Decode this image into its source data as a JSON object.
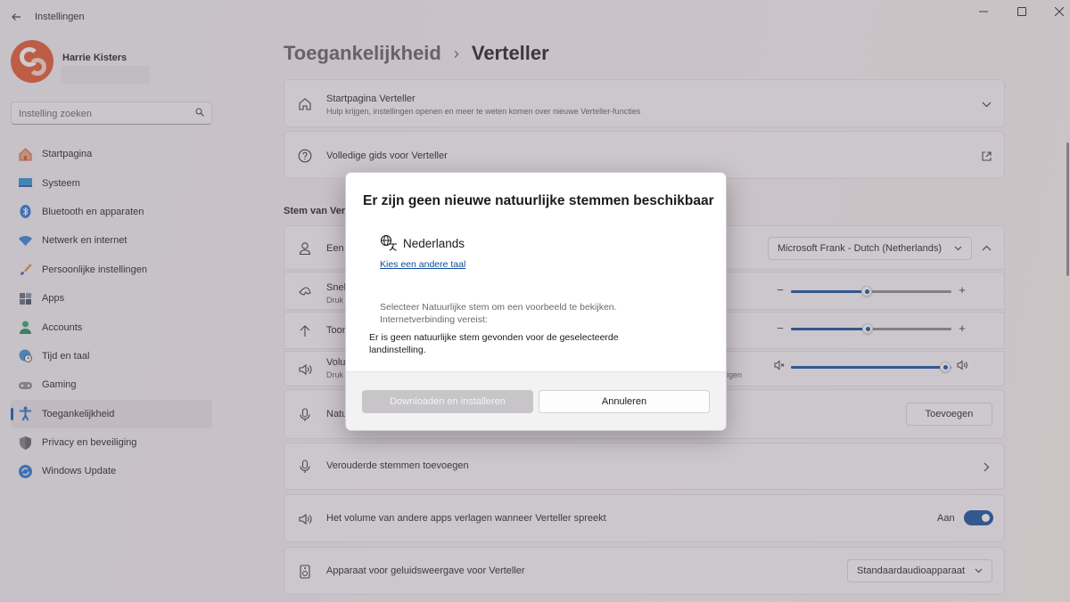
{
  "app": {
    "title": "Instellingen"
  },
  "user": {
    "name": "Harrie Kisters"
  },
  "search": {
    "placeholder": "Instelling zoeken"
  },
  "sidebar": {
    "items": [
      {
        "label": "Startpagina",
        "icon": "home-icon"
      },
      {
        "label": "Systeem",
        "icon": "monitor-icon"
      },
      {
        "label": "Bluetooth en apparaten",
        "icon": "bluetooth-icon"
      },
      {
        "label": "Netwerk en internet",
        "icon": "wifi-icon"
      },
      {
        "label": "Persoonlijke instellingen",
        "icon": "brush-icon"
      },
      {
        "label": "Apps",
        "icon": "apps-icon"
      },
      {
        "label": "Accounts",
        "icon": "person-icon"
      },
      {
        "label": "Tijd en taal",
        "icon": "globe-clock-icon"
      },
      {
        "label": "Gaming",
        "icon": "gamepad-icon"
      },
      {
        "label": "Toegankelijkheid",
        "icon": "accessibility-icon",
        "active": true
      },
      {
        "label": "Privacy en beveiliging",
        "icon": "shield-icon"
      },
      {
        "label": "Windows Update",
        "icon": "update-icon"
      }
    ]
  },
  "breadcrumb": {
    "parent": "Toegankelijkheid",
    "separator": "›",
    "current": "Verteller"
  },
  "cards": {
    "home": {
      "title": "Startpagina Verteller",
      "subtitle": "Hulp krijgen, instellingen openen en meer te weten komen over nieuwe Verteller-functies"
    },
    "guide": {
      "title": "Volledige gids voor Verteller"
    },
    "section_title": "Stem van Verteller",
    "voice": {
      "title": "Een",
      "dropdown": "Microsoft Frank - Dutch (Netherlands)"
    },
    "speed": {
      "title": "Snel",
      "subtitle": "Druk",
      "level": 0.47
    },
    "pitch": {
      "title": "Toon",
      "level": 0.48
    },
    "volume": {
      "title": "Volu",
      "subtitle": "Druk",
      "subtitle_tail": "igen",
      "level": 0.96
    },
    "natural": {
      "title": "Natu",
      "button": "Toevoegen"
    },
    "legacy": {
      "title": "Verouderde stemmen toevoegen"
    },
    "duck": {
      "title": "Het volume van andere apps verlagen wanneer Verteller spreekt",
      "state_label": "Aan",
      "on": true
    },
    "device": {
      "title": "Apparaat voor geluidsweergave voor Verteller",
      "dropdown": "Standaardaudioapparaat"
    }
  },
  "dialog": {
    "title": "Er zijn geen nieuwe natuurlijke stemmen beschikbaar",
    "language": "Nederlands",
    "change_language_link": "Kies een andere taal",
    "hint_line1": "Selecteer Natuurlijke stem om een voorbeeld te bekijken.",
    "hint_line2": "Internetverbinding vereist:",
    "message": "Er is geen natuurlijke stem gevonden voor de geselecteerde landinstelling.",
    "primary_button": "Downloaden en installeren",
    "secondary_button": "Annuleren"
  },
  "colors": {
    "accent": "#0e4c9c",
    "link": "#0f4b9a",
    "brand_avatar": "#e2552a"
  }
}
